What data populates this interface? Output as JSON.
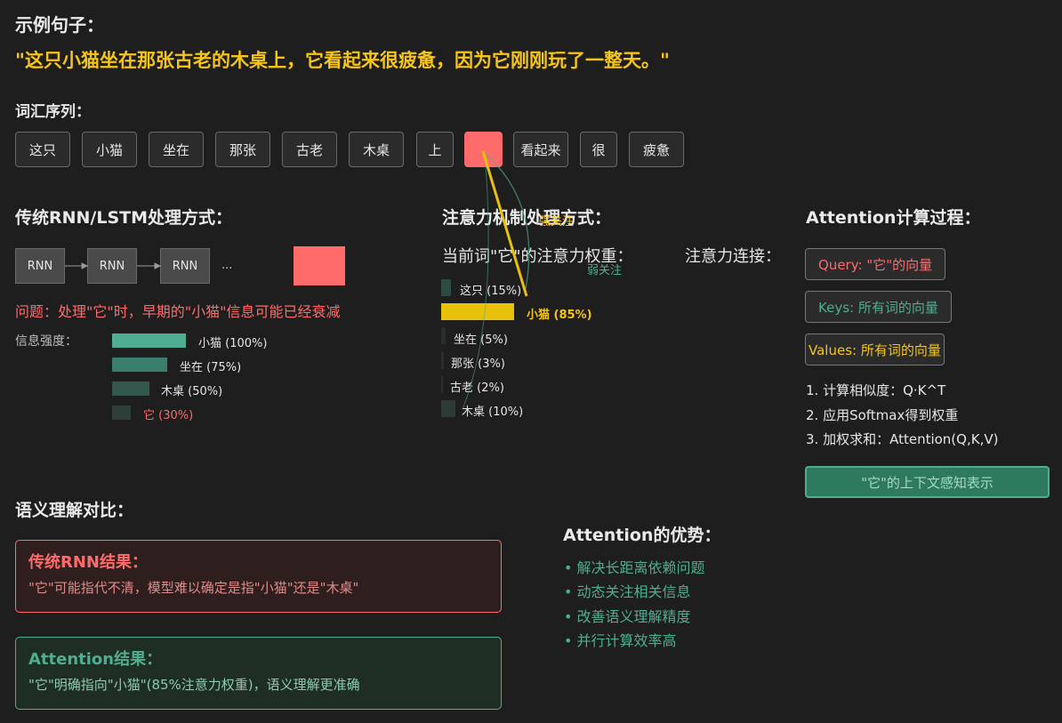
{
  "header": {
    "example_label": "示例句子：",
    "sentence": "\"这只小猫坐在那张古老的木桌上，它看起来很疲惫，因为它刚刚玩了一整天。\""
  },
  "tokens": {
    "label": "词汇序列：",
    "items": [
      "这只",
      "小猫",
      "坐在",
      "那张",
      "古老",
      "木桌",
      "上",
      "",
      "看起来",
      "很",
      "疲惫"
    ]
  },
  "rnn": {
    "title": "传统RNN/LSTM处理方式：",
    "cells": [
      "RNN",
      "RNN",
      "RNN"
    ],
    "ellipsis": "...",
    "problem": "问题：处理\"它\"时，早期的\"小猫\"信息可能已经衰减",
    "strength_label": "信息强度：",
    "strengths": [
      {
        "label": "小猫 (100%)",
        "value": 100
      },
      {
        "label": "坐在 (75%)",
        "value": 75
      },
      {
        "label": "木桌 (50%)",
        "value": 50
      },
      {
        "label": "它 (30%)",
        "value": 30
      }
    ]
  },
  "attention": {
    "title": "注意力机制处理方式：",
    "weights_label": "当前词\"它\"的注意力权重：",
    "connection_label": "注意力连接：",
    "strong_label": "强关注",
    "weak_label": "弱关注",
    "weights": [
      {
        "label": "这只 (15%)",
        "value": 15
      },
      {
        "label": "小猫 (85%)",
        "value": 85
      },
      {
        "label": "坐在 (5%)",
        "value": 5
      },
      {
        "label": "那张 (3%)",
        "value": 3
      },
      {
        "label": "古老 (2%)",
        "value": 2
      },
      {
        "label": "木桌 (10%)",
        "value": 10
      }
    ]
  },
  "process": {
    "title": "Attention计算过程：",
    "query": "Query: \"它\"的向量",
    "keys": "Keys: 所有词的向量",
    "values": "Values: 所有词的向量",
    "steps": [
      "1. 计算相似度：Q·K^T",
      "2. 应用Softmax得到权重",
      "3. 加权求和：Attention(Q,K,V)"
    ],
    "output": "\"它\"的上下文感知表示"
  },
  "comparison": {
    "title": "语义理解对比：",
    "rnn_title": "传统RNN结果：",
    "rnn_desc": "\"它\"可能指代不清，模型难以确定是指\"小猫\"还是\"木桌\"",
    "att_title": "Attention结果：",
    "att_desc": "\"它\"明确指向\"小猫\"(85%注意力权重)，语义理解更准确"
  },
  "advantages": {
    "title": "Attention的优势：",
    "items": [
      "• 解决长距离依赖问题",
      "• 动态关注相关信息",
      "• 改善语义理解精度",
      "• 并行计算效率高"
    ]
  },
  "colors": {
    "accent_yellow": "#f5c518",
    "accent_red": "#ff6b6b",
    "accent_teal": "#4fae92"
  }
}
